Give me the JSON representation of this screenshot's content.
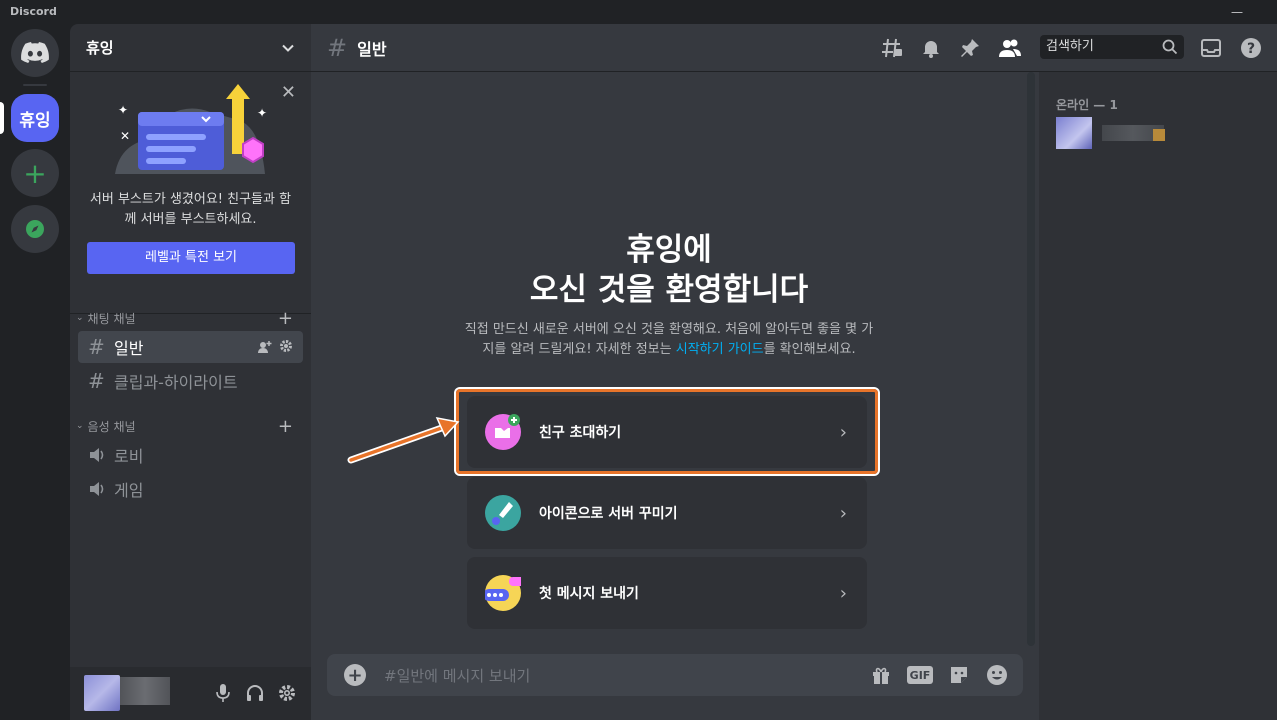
{
  "window": {
    "app_name": "Discord",
    "minimize": "—",
    "maximize": "☐",
    "close": "✕"
  },
  "servers": {
    "active_label": "휴잉",
    "add_label": "+"
  },
  "guild": {
    "name": "휴잉"
  },
  "boost": {
    "text": "서버 부스트가 생겼어요! 친구들과 함께 서버를 부스트하세요.",
    "button": "레벨과 특전 보기"
  },
  "categories": [
    {
      "label": "채팅 채널",
      "channels": [
        {
          "name": "일반",
          "active": true
        },
        {
          "name": "클립과-하이라이트",
          "active": false
        }
      ]
    },
    {
      "label": "음성 채널",
      "channels": [
        {
          "name": "로비"
        },
        {
          "name": "게임"
        }
      ]
    }
  ],
  "header": {
    "channel_name": "일반",
    "search_placeholder": "검색하기"
  },
  "welcome": {
    "title_line1": "휴잉에",
    "title_line2": "오신 것을 환영합니다",
    "desc_before": "직접 만드신 새로운 서버에 오신 것을 환영해요. 처음에 알아두면 좋을 몇 가지를 알려 드릴게요! 자세한 정보는 ",
    "desc_link": "시작하기 가이드",
    "desc_after": "를 확인해보세요."
  },
  "actions": [
    {
      "label": "친구 초대하기",
      "icon": "invite-friends-icon"
    },
    {
      "label": "아이콘으로 서버 꾸미기",
      "icon": "brush-icon"
    },
    {
      "label": "첫 메시지 보내기",
      "icon": "message-bubble-icon"
    }
  ],
  "composer": {
    "placeholder": "#일반에 메시지 보내기",
    "gif_label": "GIF"
  },
  "members": {
    "header": "온라인 — 1"
  },
  "colors": {
    "accent": "#5865f2",
    "highlight": "#e8742a",
    "link": "#00b0f4",
    "online": "#3ba55d"
  }
}
